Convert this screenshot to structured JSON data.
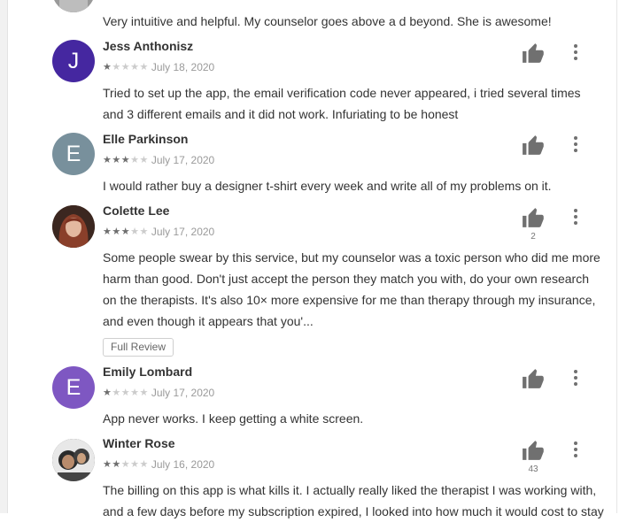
{
  "reviews": [
    {
      "name": "",
      "avatar_letter": "",
      "avatar_color": "#888888",
      "rating": 0,
      "date": "",
      "text": "Very intuitive and helpful. My counselor goes above a d beyond. She is awesome!"
    },
    {
      "name": "Jess Anthonisz",
      "avatar_letter": "J",
      "avatar_color": "#4527a0",
      "rating": 1,
      "date": "July 18, 2020",
      "text": "Tried to set up the app, the email verification code never appeared, i tried several times and 3 different emails and it did not work. Infuriating to be honest"
    },
    {
      "name": "Elle Parkinson",
      "avatar_letter": "E",
      "avatar_color": "#78909c",
      "rating": 3,
      "date": "July 17, 2020",
      "text": "I would rather buy a designer t-shirt every week and write all of my problems on it."
    },
    {
      "name": "Colette Lee",
      "avatar_letter": "",
      "avatar_color": "#5a3a2e",
      "rating": 3,
      "date": "July 17, 2020",
      "likes": "2",
      "text": "Some people swear by this service, but my counselor was a toxic person who did me more harm than good. Don't just accept the person they match you with, do your own research on the therapists. It's also 10× more expensive for me than therapy through my insurance, and even though it appears that you'...",
      "full_review_label": "Full Review"
    },
    {
      "name": "Emily Lombard",
      "avatar_letter": "E",
      "avatar_color": "#7e57c2",
      "rating": 1,
      "date": "July 17, 2020",
      "text": "App never works. I keep getting a white screen."
    },
    {
      "name": "Winter Rose",
      "avatar_letter": "",
      "avatar_color": "#3a3a3a",
      "rating": 2,
      "date": "July 16, 2020",
      "likes": "43",
      "text": "The billing on this app is what kills it. I actually really liked the therapist I was working with, and a few days before my subscription expired, I looked into how much it would cost to stay"
    }
  ],
  "icons": {
    "like": "thumbs-up-icon",
    "more": "more-vert-icon",
    "star": "star-icon"
  },
  "colors": {
    "icon": "#707070",
    "star_on": "#6e6e6e",
    "star_off": "#cccccc",
    "date": "#9a9a9a"
  }
}
